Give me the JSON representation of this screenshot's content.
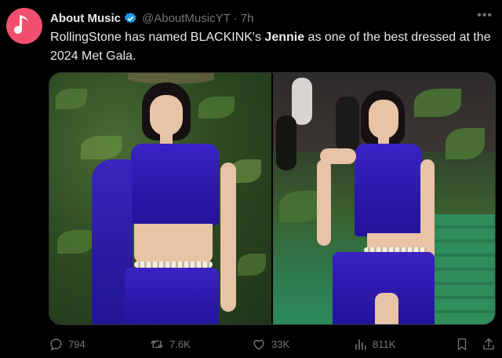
{
  "post": {
    "author_name": "About Music",
    "handle": "@AboutMusicYT",
    "separator": "·",
    "time": "7h",
    "more_icon": "more-dots-icon",
    "text_prefix": "RollingStone has named BLACKINK's ",
    "text_bold": "Jennie",
    "text_suffix": " as one of the best dressed at the 2024 Met Gala.",
    "avatar_color": "#f0506e",
    "verified_color": "#1d9bf0"
  },
  "media": {
    "images": [
      {
        "icon": "photo-icon"
      },
      {
        "icon": "photo-icon"
      }
    ],
    "dress_color": "#2a18a8"
  },
  "actions": {
    "replies": "794",
    "reposts": "7.6K",
    "likes": "33K",
    "views": "811K",
    "muted_color": "#71767b"
  }
}
